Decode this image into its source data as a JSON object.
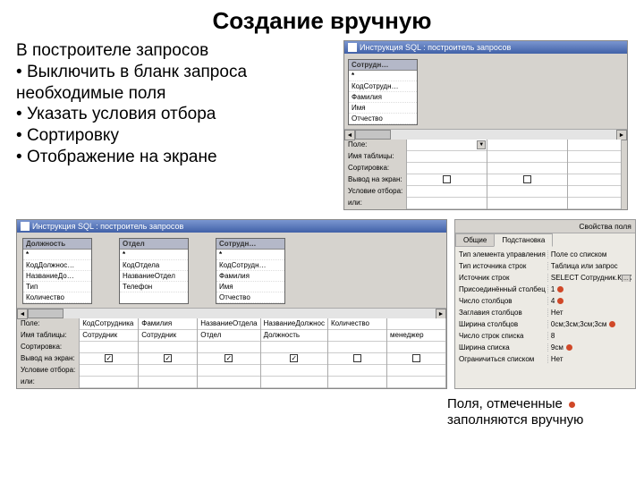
{
  "title": "Создание вручную",
  "intro": "В построителе запросов",
  "bullets": [
    "Выключить в бланк запроса необходимые поля",
    "Указать условия отбора",
    "Сортировку",
    "Отображение на экране"
  ],
  "qb_top": {
    "window_title": "Инструкция SQL : построитель запросов",
    "table": {
      "name": "Сотрудн…",
      "fields": [
        "*",
        "КодСотрудн…",
        "Фамилия",
        "Имя",
        "Отчество"
      ]
    },
    "row_labels": [
      "Поле:",
      "Имя таблицы:",
      "Сортировка:",
      "Вывод на экран:",
      "Условие отбора:",
      "или:"
    ],
    "cols": [
      {
        "field": "",
        "table": "",
        "sort": "",
        "show": false
      },
      {
        "field": "",
        "table": "",
        "sort": "",
        "show": false
      }
    ]
  },
  "qb_bottom": {
    "window_title": "Инструкция SQL : построитель запросов",
    "tables": [
      {
        "name": "Должность",
        "fields": [
          "*",
          "КодДолжнос…",
          "НазваниеДо…",
          "Тип",
          "Количество"
        ]
      },
      {
        "name": "Отдел",
        "fields": [
          "*",
          "КодОтдела",
          "НазваниеОтдел",
          "Телефон"
        ]
      },
      {
        "name": "Сотрудн…",
        "fields": [
          "*",
          "КодСотрудн…",
          "Фамилия",
          "Имя",
          "Отчество"
        ]
      }
    ],
    "row_labels": [
      "Поле:",
      "Имя таблицы:",
      "Сортировка:",
      "Вывод на экран:",
      "Условие отбора:",
      "или:"
    ],
    "cols": [
      {
        "field": "КодСотрудника",
        "table": "Сотрудник",
        "sort": "",
        "show": true,
        "cond": ""
      },
      {
        "field": "Фамилия",
        "table": "Сотрудник",
        "sort": "",
        "show": true,
        "cond": ""
      },
      {
        "field": "НазваниеОтдела",
        "table": "Отдел",
        "sort": "",
        "show": true,
        "cond": ""
      },
      {
        "field": "НазваниеДолжнос",
        "table": "Должность",
        "sort": "",
        "show": true,
        "cond": ""
      },
      {
        "field": "Количество",
        "table": "",
        "sort": "",
        "show": false,
        "cond": ""
      },
      {
        "field": "",
        "table": "менеджер",
        "sort": "",
        "show": false,
        "cond": ""
      }
    ]
  },
  "props": {
    "title": "Свойства поля",
    "tabs": [
      "Общие",
      "Подстановка"
    ],
    "active_tab": 1,
    "rows": [
      {
        "name": "Тип элемента управления",
        "val": "Поле со списком",
        "dot": false
      },
      {
        "name": "Тип источника строк",
        "val": "Таблица или запрос",
        "dot": false
      },
      {
        "name": "Источник строк",
        "val": "SELECT Сотрудник.КодСотруд…",
        "dot": true,
        "dd": true
      },
      {
        "name": "Присоединённый столбец",
        "val": "1",
        "dot": true
      },
      {
        "name": "Число столбцов",
        "val": "4",
        "dot": true
      },
      {
        "name": "Заглавия столбцов",
        "val": "Нет",
        "dot": false
      },
      {
        "name": "Ширина столбцов",
        "val": "0см;3см;3см;3см",
        "dot": true
      },
      {
        "name": "Число строк списка",
        "val": "8",
        "dot": false
      },
      {
        "name": "Ширина списка",
        "val": "9см",
        "dot": true
      },
      {
        "name": "Ограничиться списком",
        "val": "Нет",
        "dot": false
      }
    ]
  },
  "footer": {
    "line1": "Поля, отмеченные",
    "line2": "заполняются вручную"
  }
}
